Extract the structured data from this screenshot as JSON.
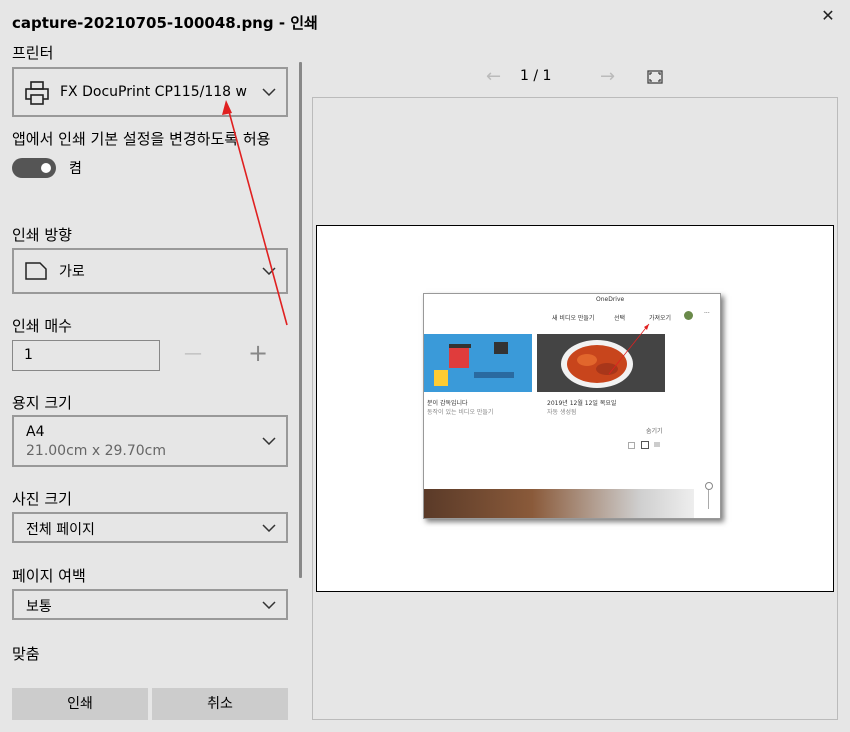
{
  "window": {
    "title": "capture-20210705-100048.png - 인쇄",
    "close_glyph": "✕"
  },
  "printer": {
    "label": "프린터",
    "selected": "FX DocuPrint CP115/118 w"
  },
  "app_settings": {
    "label": "앱에서 인쇄 기본 설정을 변경하도록 허용",
    "toggle_state": "켬"
  },
  "orientation": {
    "label": "인쇄 방향",
    "selected": "가로"
  },
  "copies": {
    "label": "인쇄 매수",
    "value": "1",
    "minus": "—",
    "plus": "+"
  },
  "paper_size": {
    "label": "용지 크기",
    "selected": "A4",
    "detail": "21.00cm x 29.70cm"
  },
  "photo_size": {
    "label": "사진 크기",
    "selected": "전체 페이지"
  },
  "margins": {
    "label": "페이지 여백",
    "selected": "보통"
  },
  "fit": {
    "label": "맞춤"
  },
  "actions": {
    "print": "인쇄",
    "cancel": "취소"
  },
  "preview": {
    "page_info": "1  /  1",
    "prev_glyph": "←",
    "next_glyph": "→",
    "thumbnail": {
      "app_title": "OneDrive",
      "toolbar_new_video": "새 비디오 만들기",
      "toolbar_select": "선택",
      "toolbar_import": "가져오기",
      "card1_title": "분이 감독입니다",
      "card1_sub": "동작이 있는 비디오 만들기",
      "card2_title": "2019년 12월 12일 목요일",
      "card2_sub": "자동 생성됨",
      "hide": "숨기기"
    }
  },
  "colors": {
    "annotation_arrow": "#e02020",
    "background": "#e6e6e6"
  }
}
